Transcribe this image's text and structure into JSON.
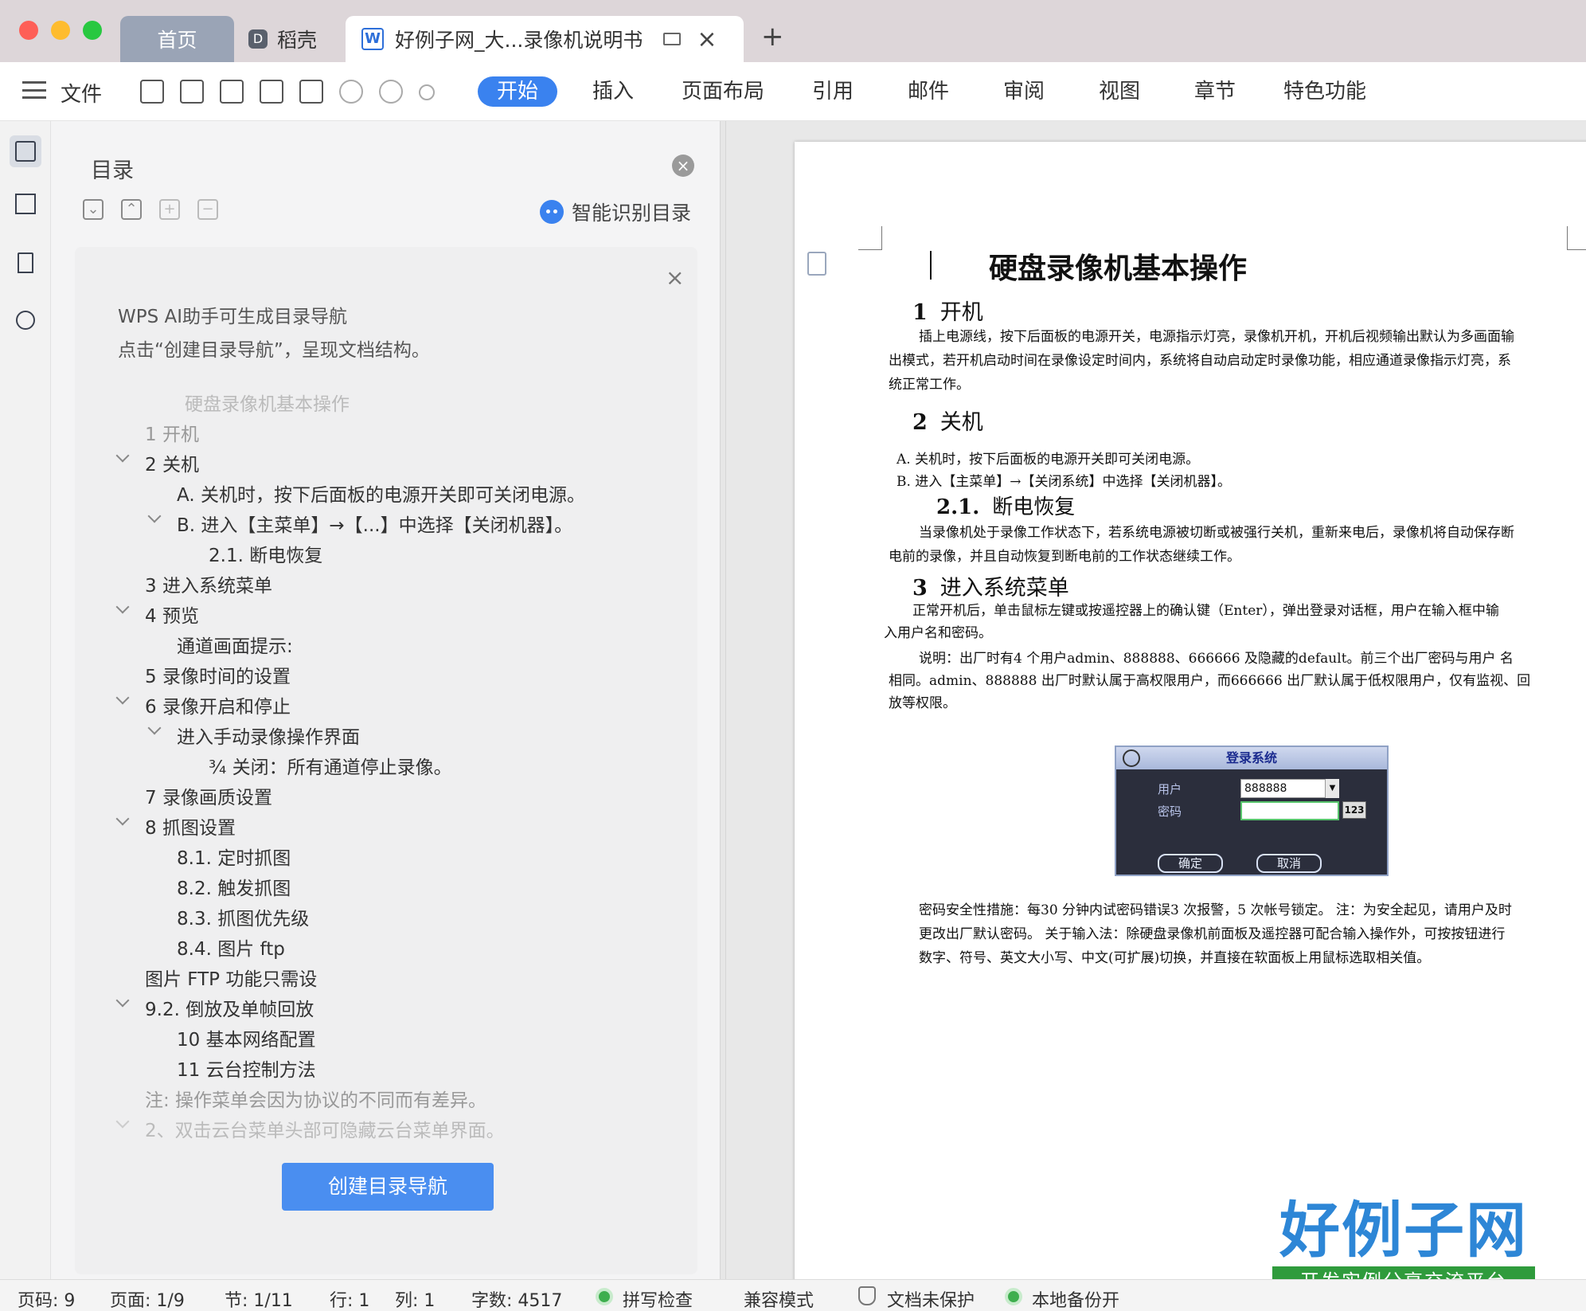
{
  "window": {
    "tabs": {
      "home": "首页",
      "daoke": "稻壳",
      "document": "好例子网_大...录像机说明书"
    }
  },
  "toolbar": {
    "file": "文件",
    "ribbon_tabs": [
      "开始",
      "插入",
      "页面布局",
      "引用",
      "邮件",
      "审阅",
      "视图",
      "章节",
      "特色功能"
    ],
    "active_tab": "开始"
  },
  "toc_panel": {
    "title": "目录",
    "smart_toc": "智能识别目录",
    "ai_hint_line1": "WPS AI助手可生成目录导航",
    "ai_hint_line2": "点击“创建目录导航”，呈现文档结构。",
    "entries": [
      {
        "text": "硬盘录像机基本操作",
        "style": "faded"
      },
      {
        "text": "1 开机",
        "style": "mid"
      },
      {
        "text": "2 关机",
        "style": "normal"
      },
      {
        "text": "A. 关机时，按下后面板的电源开关即可关闭电源。",
        "style": "normal"
      },
      {
        "text": "B. 进入【主菜单】→【...】中选择【关闭机器】。",
        "style": "normal"
      },
      {
        "text": "2.1.    断电恢复",
        "style": "normal"
      },
      {
        "text": "3 进入系统菜单",
        "style": "normal"
      },
      {
        "text": "4 预览",
        "style": "normal"
      },
      {
        "text": "通道画面提示:",
        "style": "normal"
      },
      {
        "text": "5 录像时间的设置",
        "style": "normal"
      },
      {
        "text": "6 录像开启和停止",
        "style": "normal"
      },
      {
        "text": "进入手动录像操作界面",
        "style": "normal"
      },
      {
        "text": "¾  关闭：所有通道停止录像。",
        "style": "normal"
      },
      {
        "text": "7 录像画质设置",
        "style": "normal"
      },
      {
        "text": "8 抓图设置",
        "style": "normal"
      },
      {
        "text": "8.1.    定时抓图",
        "style": "normal"
      },
      {
        "text": "8.2.    触发抓图",
        "style": "normal"
      },
      {
        "text": "8.3.    抓图优先级",
        "style": "normal"
      },
      {
        "text": "8.4.    图片 ftp",
        "style": "normal"
      },
      {
        "text": "图片 FTP 功能只需设",
        "style": "normal"
      },
      {
        "text": "9.2. 倒放及单帧回放",
        "style": "normal"
      },
      {
        "text": "10 基本网络配置",
        "style": "normal"
      },
      {
        "text": "11 云台控制方法",
        "style": "normal"
      },
      {
        "text": "注: 操作菜单会因为协议的不同而有差异。",
        "style": "mid"
      },
      {
        "text": "2、双击云台菜单头部可隐藏云台菜单界面。",
        "style": "faded"
      }
    ],
    "create_button": "创建目录导航"
  },
  "document": {
    "title": "硬盘录像机基本操作",
    "sec1_num": "1",
    "sec1_title": "开机",
    "sec1_p1": "插上电源线，按下后面板的电源开关，电源指示灯亮，录像机开机，开机后视频输出默认为多画面输",
    "sec1_p2": "出模式，若开机启动时间在录像设定时间内，系统将自动启动定时录像功能，相应通道录像指示灯亮，系",
    "sec1_p3": "统正常工作。",
    "sec2_num": "2",
    "sec2_title": "关机",
    "sec2_a": "A.   关机时，按下后面板的电源开关即可关闭电源。",
    "sec2_b": "B.   进入【主菜单】→【关闭系统】中选择【关闭机器】。",
    "sec21_num": "2.1.",
    "sec21_title": "断电恢复",
    "sec21_p1": "当录像机处于录像工作状态下，若系统电源被切断或被强行关机，重新来电后，录像机将自动保存断",
    "sec21_p2": "电前的录像，并且自动恢复到断电前的工作状态继续工作。",
    "sec3_num": "3",
    "sec3_title": "进入系统菜单",
    "sec3_p1": "正常开机后，单击鼠标左键或按遥控器上的确认键（Enter），弹出登录对话框，用户在输入框中输",
    "sec3_p2": "入用户名和密码。",
    "sec3_p3": "说明：出厂时有4 个用户admin、888888、666666 及隐藏的default。前三个出厂密码与用户 名",
    "sec3_p4": "相同。admin、888888 出厂时默认属于高权限用户，而666666 出厂默认属于低权限用户，仅有监视、回",
    "sec3_p5": "放等权限。",
    "login": {
      "title": "登录系统",
      "user_label": "用户",
      "user_value": "888888",
      "password_label": "密码",
      "keyboard_button": "123",
      "ok": "确定",
      "cancel": "取消"
    },
    "note_p1": "密码安全性措施：每30 分钟内试密码错误3 次报警，5 次帐号锁定。 注：为安全起见，请用户及时",
    "note_p2": "更改出厂默认密码。 关于输入法：除硬盘录像机前面板及遥控器可配合输入操作外，可按按钮进行",
    "note_p3": "数字、符号、英文大小写、中文(可扩展)切换，并直接在软面板上用鼠标选取相关值。"
  },
  "logo": {
    "big": "好例子网",
    "small": "开发实例分享交流平台"
  },
  "statusbar": {
    "page_code": "页码: 9",
    "page": "页面: 1/9",
    "section": "节: 1/11",
    "row": "行: 1",
    "col": "列: 1",
    "word_count": "字数: 4517",
    "spell_check": "拼写检查",
    "compat_mode": "兼容模式",
    "unprotected": "文档未保护",
    "backup": "本地备份开"
  }
}
